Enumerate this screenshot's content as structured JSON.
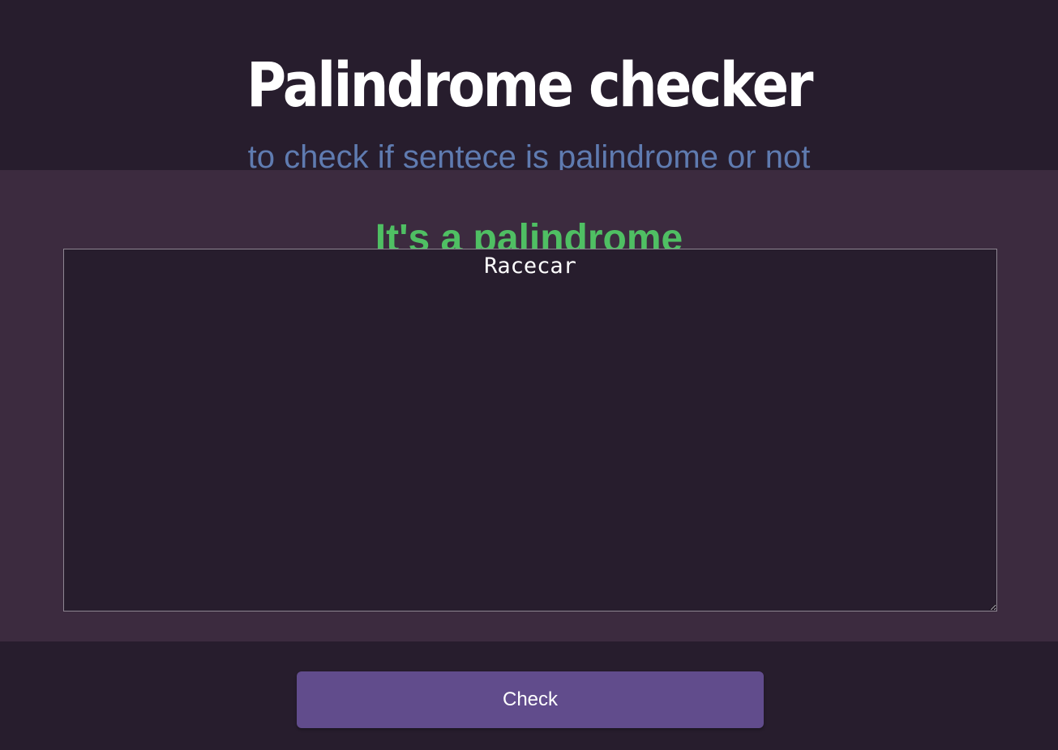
{
  "header": {
    "title": "Palindrome checker",
    "subtitle": "to check if sentece is palindrome or not"
  },
  "main": {
    "result_text": "It's a palindrome",
    "input_value": "Racecar"
  },
  "footer": {
    "check_label": "Check"
  },
  "colors": {
    "background": "#271d2d",
    "panel": "#3c2b3f",
    "subtitle": "#5f7bb0",
    "success": "#4fbf63",
    "button": "#614c8c"
  }
}
